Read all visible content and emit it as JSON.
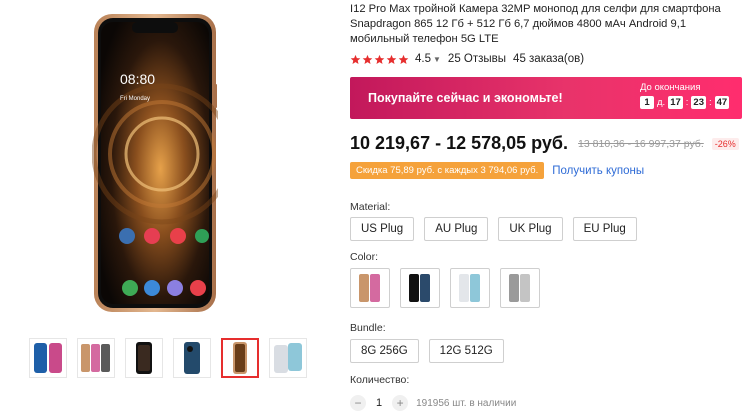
{
  "product": {
    "title": "I12 Pro Max тройной Камера 32MP монопод для селфи для смартфона Snapdragon 865 12 Гб + 512 Гб 6,7 дюймов 4800 мАч Android 9,1 мобильный телефон 5G LTE",
    "rating": "4.5",
    "stars": 5,
    "reviews": "25 Отзывы",
    "orders": "45 заказа(ов)"
  },
  "phone_screen": {
    "time": "08:80",
    "date": "Fri Monday"
  },
  "promo": {
    "text": "Покупайте сейчас и экономьте!",
    "countdown_label": "До окончания",
    "days": "1",
    "days_suffix": "д.",
    "hours": "17",
    "minutes": "23",
    "seconds": "47"
  },
  "price": {
    "current": "10 219,67 - 12 578,05 руб.",
    "old": "13 810,36 - 16 997,37 руб.",
    "discount": "-26%"
  },
  "coupon": {
    "text": "Скидка 75,89 руб. с каждых 3 794,06 руб.",
    "link": "Получить купоны"
  },
  "material": {
    "label": "Material:",
    "options": [
      "US Plug",
      "AU Plug",
      "UK Plug",
      "EU Plug"
    ]
  },
  "color": {
    "label": "Color:",
    "swatches": [
      "gold-phone",
      "black-phone",
      "white-phone",
      "gray-phone"
    ]
  },
  "bundle": {
    "label": "Bundle:",
    "options": [
      "8G 256G",
      "12G 512G"
    ]
  },
  "quantity": {
    "label": "Количество:",
    "minus": "−",
    "value": "1",
    "plus": "+",
    "stock": "191956 шт. в наличии"
  },
  "colors": {
    "accent": "#e62e2e",
    "promo_start": "#c2185b",
    "promo_end": "#ff2d6e",
    "coupon": "#f5a23b",
    "link": "#2e6bd6",
    "phone_gold": "#c9966b"
  }
}
